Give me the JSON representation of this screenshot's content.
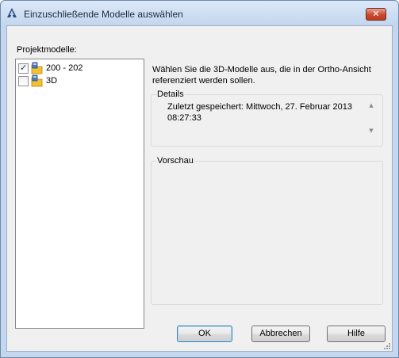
{
  "window": {
    "title": "Einzuschließende Modelle auswählen",
    "close_icon": "close-icon"
  },
  "projekt": {
    "label": "Projektmodelle:",
    "items": [
      {
        "label": "200 - 202",
        "checked": true
      },
      {
        "label": "3D",
        "checked": false
      }
    ]
  },
  "description": "Wählen Sie die 3D-Modelle aus, die in der Ortho-Ansicht referenziert werden sollen.",
  "details": {
    "title": "Details",
    "text": "Zuletzt gespeichert: Mittwoch, 27. Februar 2013 08:27:33"
  },
  "preview": {
    "title": "Vorschau"
  },
  "buttons": {
    "ok": "OK",
    "cancel": "Abbrechen",
    "help": "Hilfe"
  },
  "colors": {
    "title_bar": "#c4d7ee",
    "close_button": "#c8492f",
    "client_bg": "#f0f0f0"
  }
}
